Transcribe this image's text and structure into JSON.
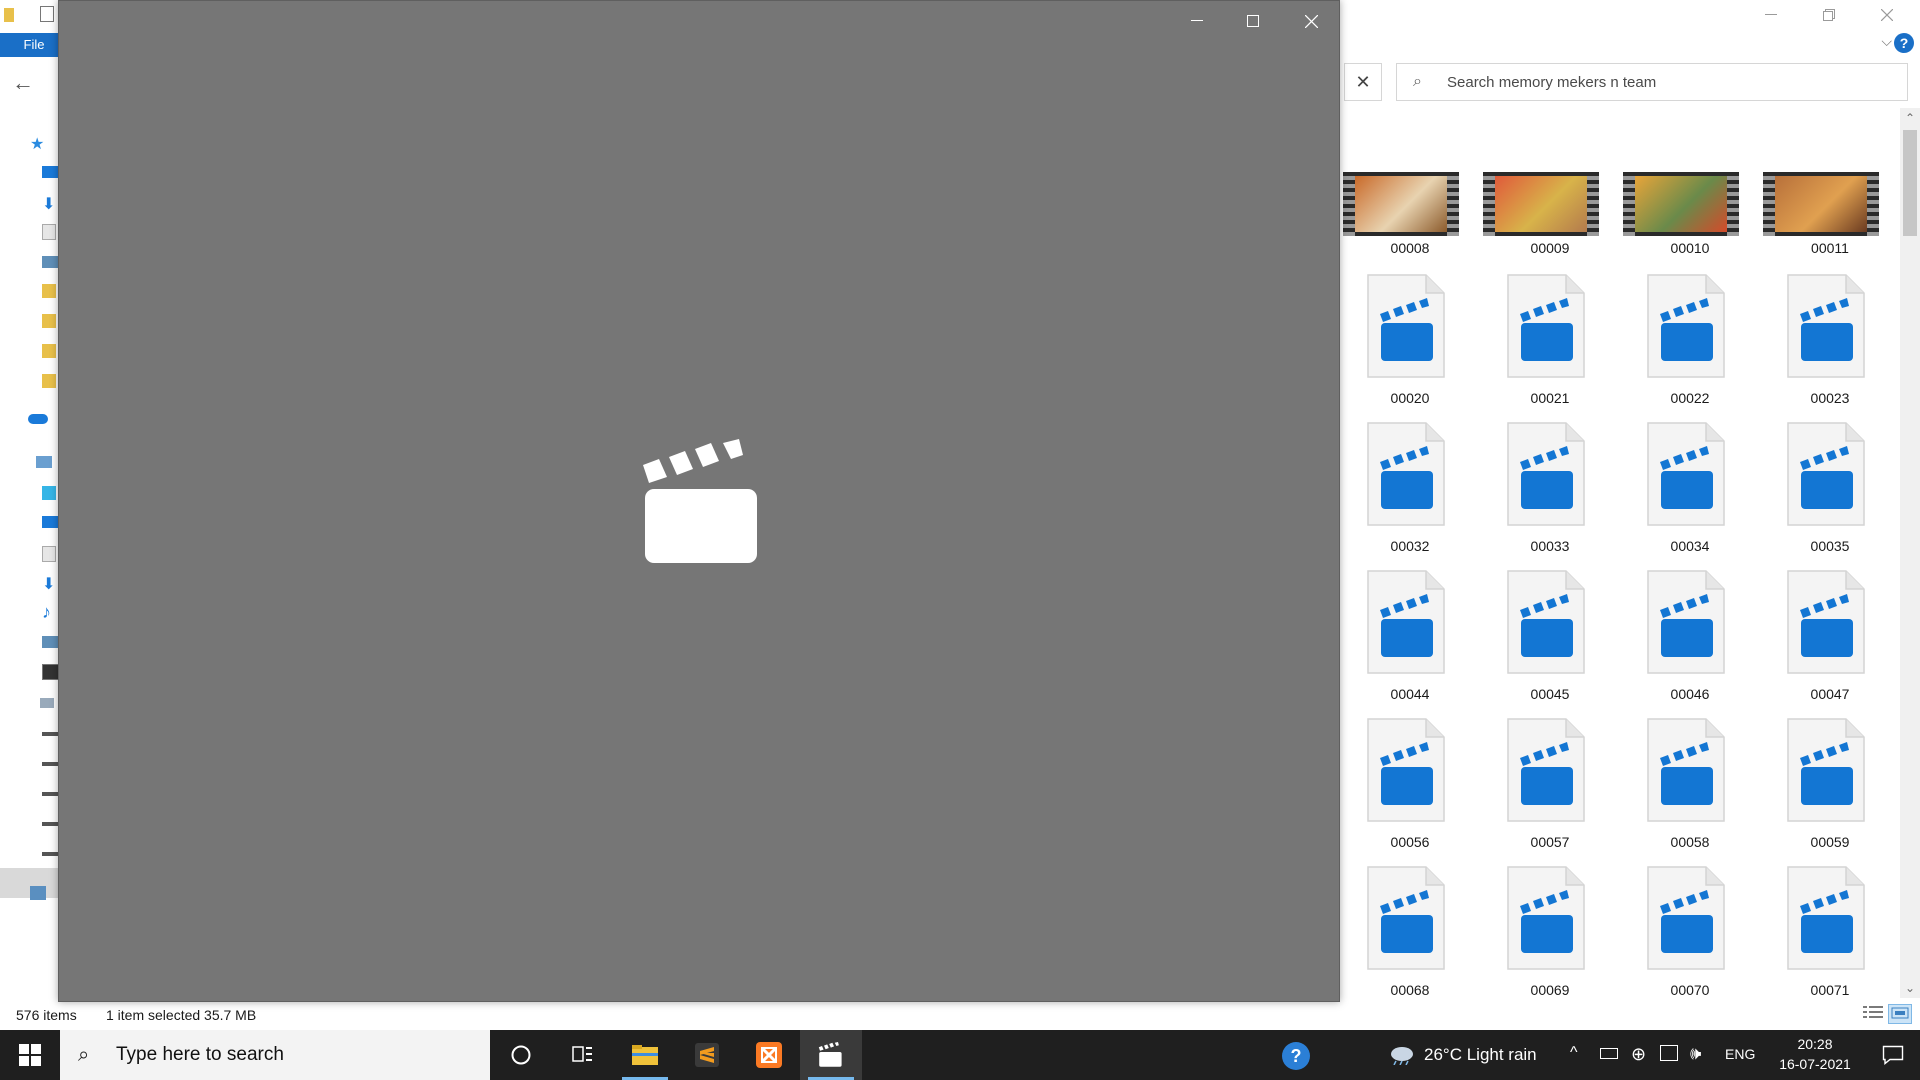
{
  "explorer": {
    "file_tab_label": "File",
    "help_glyph": "?",
    "search_placeholder": "Search memory mekers n team",
    "status": {
      "item_count": "576 items",
      "selection": "1 item selected  35.7 MB"
    },
    "video_thumbnails": [
      {
        "name": "00008",
        "colors": [
          "#c96a2a",
          "#e8d3b0",
          "#8b5a2b"
        ]
      },
      {
        "name": "00009",
        "colors": [
          "#e05a3a",
          "#d8b34a",
          "#b37a4c"
        ]
      },
      {
        "name": "00010",
        "colors": [
          "#e8a53a",
          "#6a8a4a",
          "#d44a2a"
        ]
      },
      {
        "name": "00011",
        "colors": [
          "#b8703a",
          "#e0a050",
          "#6a3a20"
        ]
      }
    ],
    "video_files": [
      "00020",
      "00021",
      "00022",
      "00023",
      "00032",
      "00033",
      "00034",
      "00035",
      "00044",
      "00045",
      "00046",
      "00047",
      "00056",
      "00057",
      "00058",
      "00059",
      "00068",
      "00069",
      "00070",
      "00071"
    ]
  },
  "player": {
    "icon": "clapperboard-icon"
  },
  "taskbar": {
    "search_text": "Type here to search",
    "weather": "26°C  Light rain",
    "language": "ENG",
    "time": "20:28",
    "date": "16-07-2021"
  },
  "colors": {
    "accent": "#1a6fc7",
    "player_bg": "#767676",
    "taskbar_bg": "#1f1f1f",
    "video_icon_blue": "#1376d3"
  }
}
